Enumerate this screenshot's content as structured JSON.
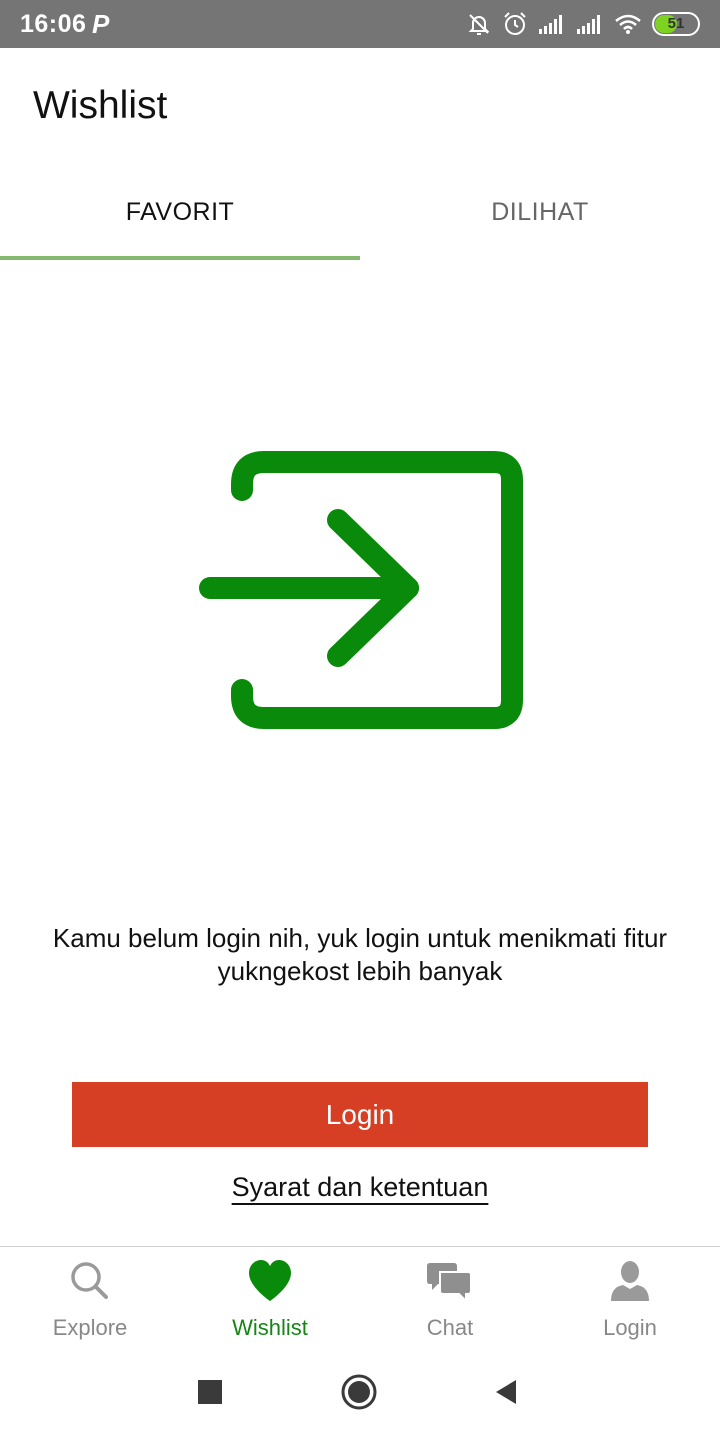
{
  "status_bar": {
    "time": "16:06",
    "notification_glyph": "P",
    "battery_level": "51",
    "icons": [
      "muted-bell-icon",
      "alarm-icon",
      "signal-icon",
      "signal-icon",
      "wifi-icon",
      "battery-icon"
    ]
  },
  "header": {
    "title": "Wishlist"
  },
  "tabs": [
    {
      "label": "FAVORIT",
      "active": true
    },
    {
      "label": "DILIHAT",
      "active": false
    }
  ],
  "illustration": {
    "icon": "login-enter-icon",
    "color": "#0a8a0a"
  },
  "message": "Kamu belum login nih, yuk login untuk menikmati fitur yukngekost lebih banyak",
  "login_button": {
    "label": "Login",
    "color": "#d63f24"
  },
  "terms_link": "Syarat dan ketentuan",
  "bottom_nav": {
    "items": [
      {
        "label": "Explore",
        "icon": "search-icon",
        "active": false
      },
      {
        "label": "Wishlist",
        "icon": "heart-icon",
        "active": true
      },
      {
        "label": "Chat",
        "icon": "chat-icon",
        "active": false
      },
      {
        "label": "Login",
        "icon": "user-icon",
        "active": false
      }
    ],
    "active_color": "#138613",
    "inactive_color": "#888888"
  },
  "system_nav": {
    "icons": [
      "recents-icon",
      "home-icon",
      "back-icon"
    ]
  }
}
